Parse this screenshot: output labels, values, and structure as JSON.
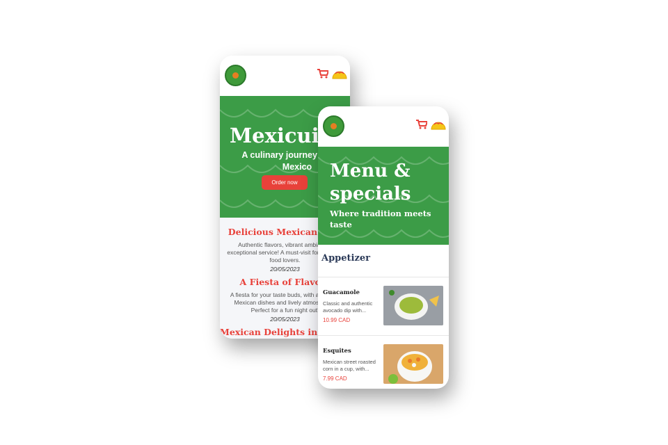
{
  "back_screen": {
    "hero": {
      "title": "Mexicuisine",
      "subtitle": "A culinary journey through Mexico",
      "order_button": "Order now"
    },
    "reviews": [
      {
        "title": "Delicious Mexican Fare",
        "body": "Authentic flavors, vibrant ambiance, exceptional service! A must-visit for Mexican food lovers.",
        "date": "20/05/2023"
      },
      {
        "title": "A Fiesta of Flavors",
        "body": "A fiesta for your taste buds, with authentic Mexican dishes and lively atmosphere. Perfect for a fun night out!",
        "date": "20/05/2023"
      },
      {
        "title": "Mexican Delights in Every Bite",
        "body": "",
        "date": ""
      }
    ]
  },
  "front_screen": {
    "hero": {
      "title": "Menu & specials",
      "subtitle": "Where tradition meets taste"
    },
    "section_title": "Appetizer",
    "items": [
      {
        "name": "Guacamole",
        "description": "Classic and authentic avocado dip with...",
        "price": "10.99 CAD"
      },
      {
        "name": "Esquites",
        "description": "Mexican street roasted corn in a cup, with...",
        "price": "7.99 CAD"
      }
    ]
  },
  "icons": [
    "logo-icon",
    "cart-icon",
    "taco-icon"
  ],
  "colors": {
    "green": "#3c9c47",
    "red": "#e8413a",
    "yellow": "#f5c518",
    "navy": "#2b3a58"
  }
}
